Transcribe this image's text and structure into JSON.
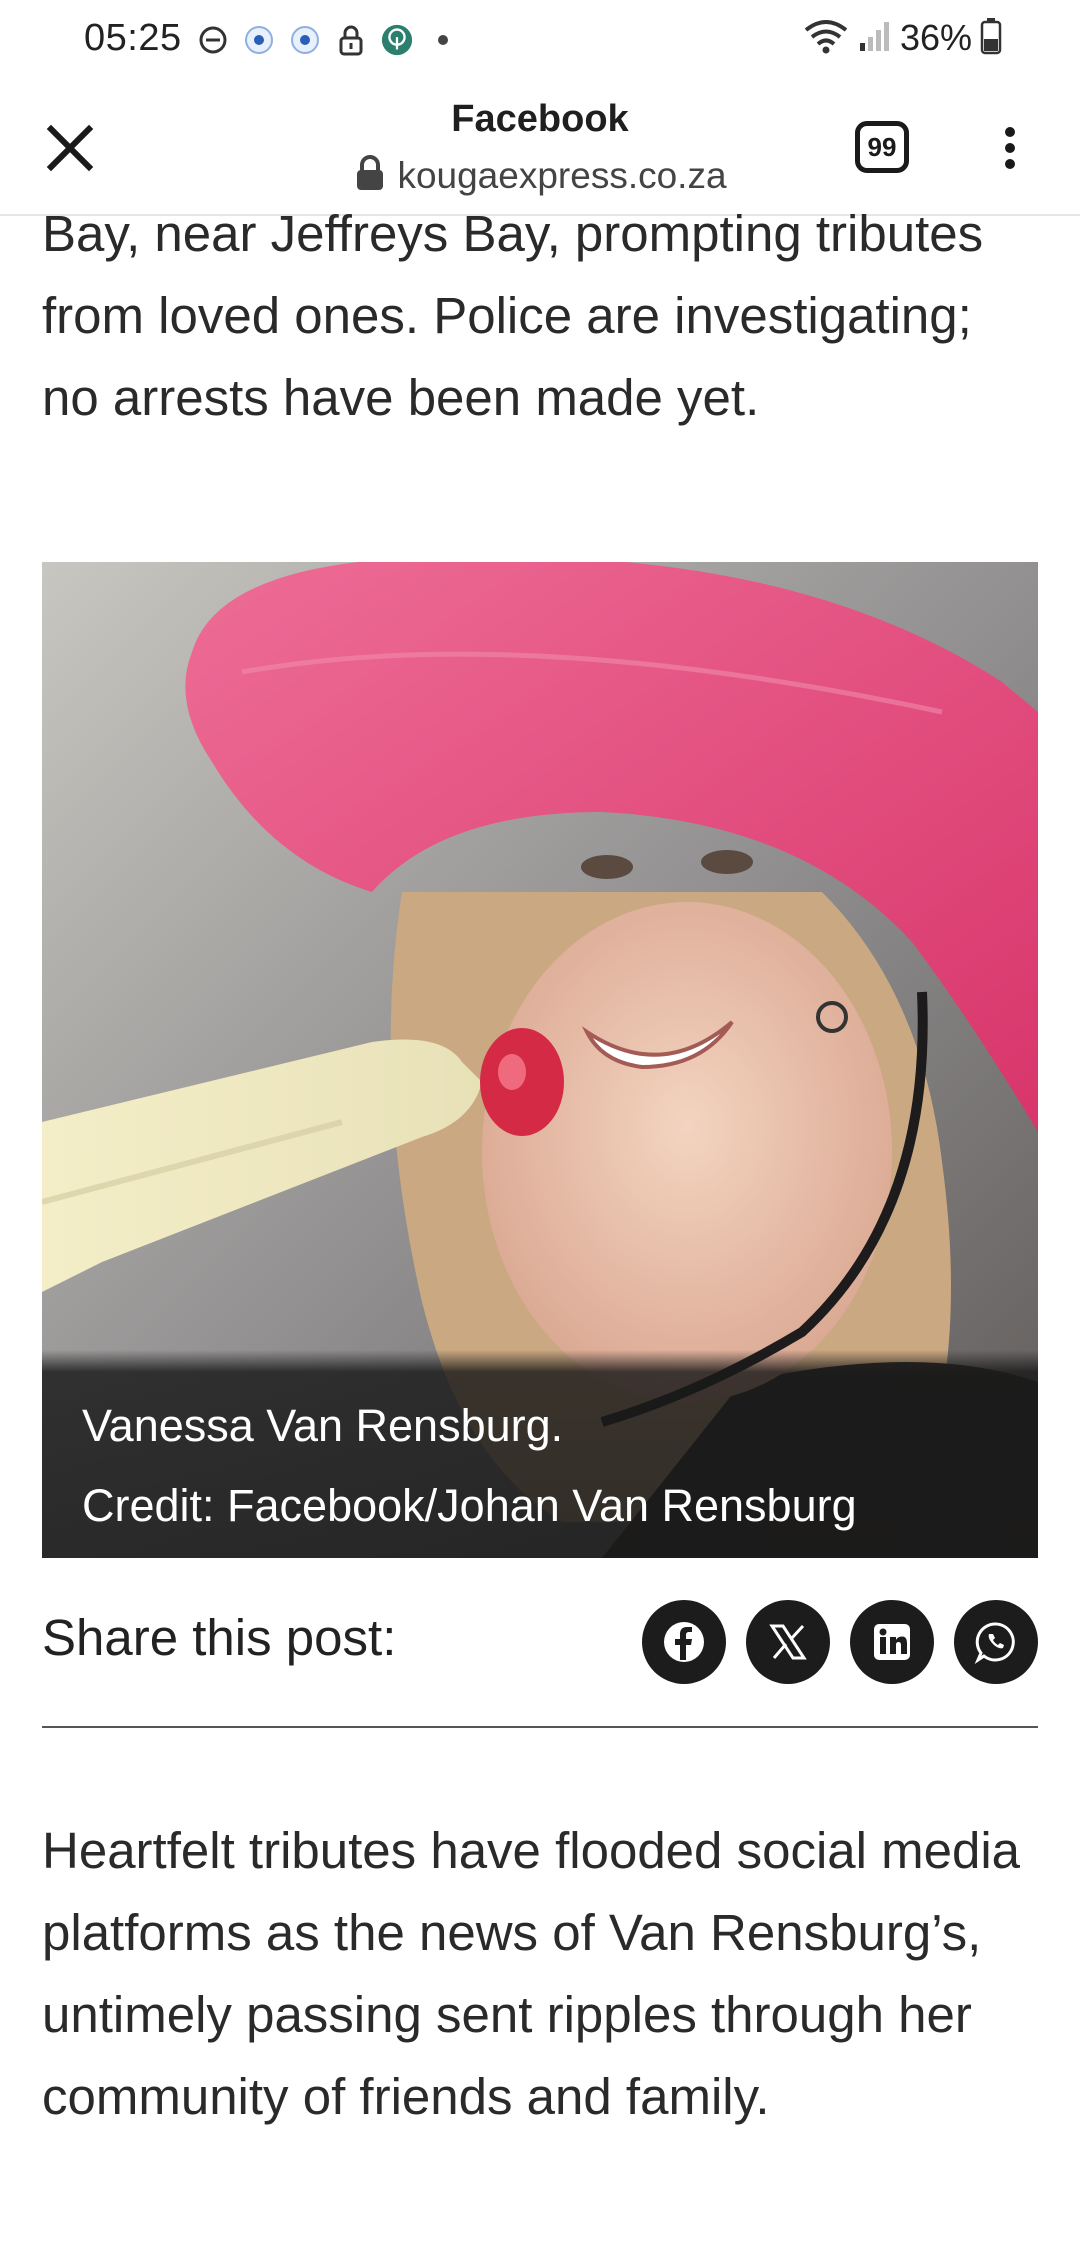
{
  "status_bar": {
    "time": "05:25",
    "battery_percent": "36%",
    "icons": [
      "do-not-disturb-icon",
      "notification-dot-icon",
      "notification-dot-icon",
      "vpn-lock-icon",
      "tree-app-icon",
      "more-dot-icon",
      "wifi-icon",
      "signal-icon",
      "battery-icon"
    ]
  },
  "toolbar": {
    "title": "Facebook",
    "url": "kougaexpress.co.za",
    "tab_count": "99"
  },
  "article": {
    "top_paragraph": "Bay, near Jeffreys Bay, prompting tributes from loved ones. Police are investigating; no arrests have been made yet.",
    "image": {
      "caption_name": "Vanessa Van Rensburg.",
      "caption_credit": "Credit: Facebook/Johan Van Rensburg"
    },
    "share": {
      "label": "Share this post:",
      "buttons": [
        "facebook-icon",
        "x-icon",
        "linkedin-icon",
        "whatsapp-icon"
      ]
    },
    "bottom_paragraph": "Heartfelt tributes have flooded social media platforms as the news of Van Rensburg’s, untimely passing sent ripples through her community of friends and family."
  },
  "colors": {
    "hat_pink": "#e0457a",
    "caption_bg": "#262626",
    "share_button_bg": "#1c1c1c"
  }
}
